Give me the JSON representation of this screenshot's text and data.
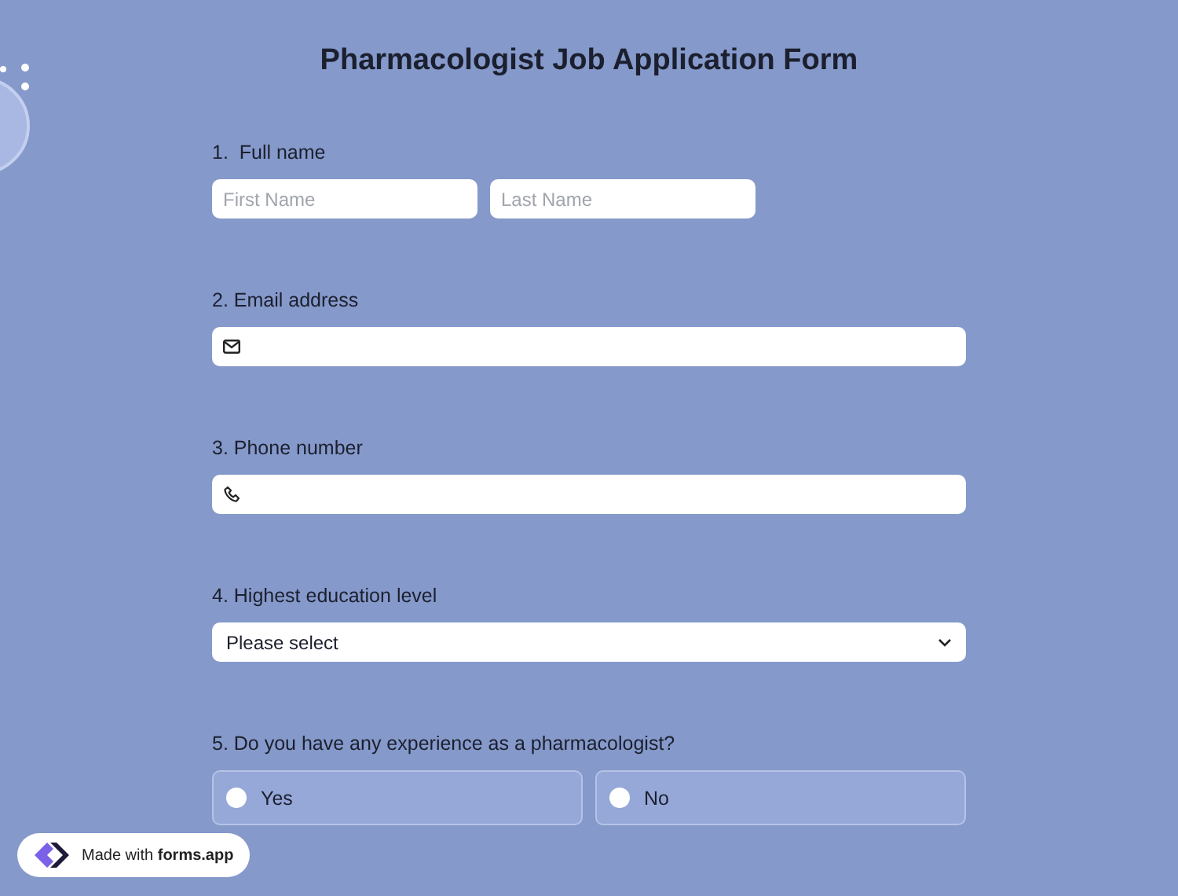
{
  "title": "Pharmacologist Job Application Form",
  "questions": [
    {
      "kind": "name",
      "label": "1.  Full name",
      "first_placeholder": "First Name",
      "last_placeholder": "Last Name"
    },
    {
      "kind": "email",
      "label": "2. Email address"
    },
    {
      "kind": "phone",
      "label": "3. Phone number"
    },
    {
      "kind": "select",
      "label": "4. Highest education level",
      "value": "Please select"
    },
    {
      "kind": "radio",
      "label": "5. Do you have any experience as a pharmacologist?",
      "options": [
        {
          "label": "Yes",
          "selected": false
        },
        {
          "label": "No",
          "selected": false
        }
      ]
    }
  ],
  "badge": {
    "prefix": "Made with",
    "brand": "forms.app"
  }
}
